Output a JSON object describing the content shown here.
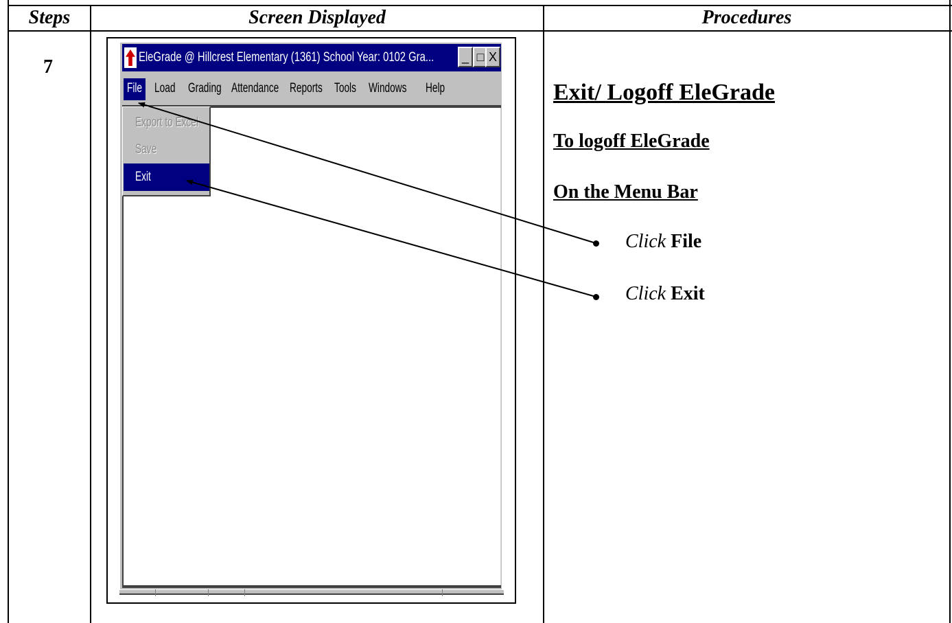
{
  "table": {
    "headers": [
      "Steps",
      "Screen Displayed",
      "Procedures"
    ],
    "step_number": "7"
  },
  "window": {
    "title": "EleGrade @ Hillcrest Elementary (1361)   School Year: 0102   Gra...",
    "controls": {
      "minimize": "_",
      "maximize": "□",
      "close": "X"
    },
    "menu": [
      "File",
      "Load",
      "Grading",
      "Attendance",
      "Reports",
      "Tools",
      "Windows",
      "Help"
    ],
    "file_menu": [
      {
        "label": "Export to Excel",
        "state": "disabled"
      },
      {
        "label": "Save",
        "state": "disabled"
      },
      {
        "label": "Exit",
        "state": "highlighted"
      }
    ]
  },
  "procedures": {
    "title": "Exit/ Logoff EleGrade",
    "subtitle1": "To logoff EleGrade",
    "subtitle2": "On the Menu Bar",
    "steps": [
      {
        "verb": "Click",
        "target": "File"
      },
      {
        "verb": "Click",
        "target": "Exit"
      }
    ]
  },
  "colors": {
    "titlebar": "#000080",
    "window_face": "#c0c0c0",
    "disabled_text": "#8a8a8a"
  }
}
